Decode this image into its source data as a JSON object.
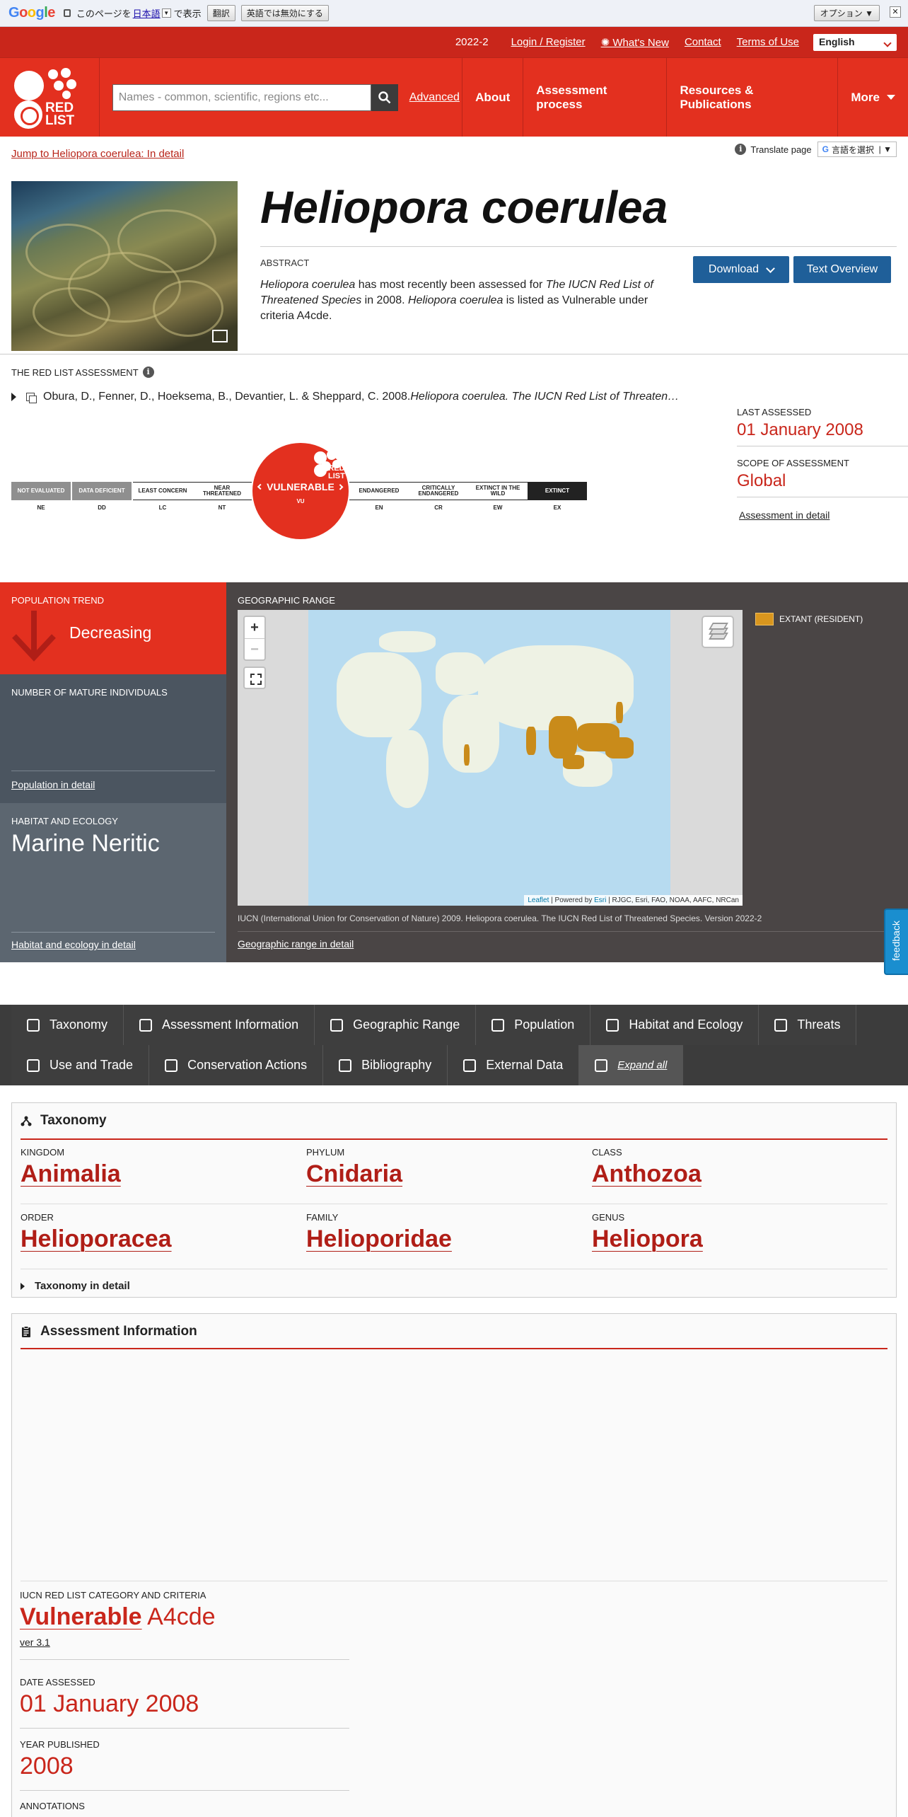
{
  "gtranslate": {
    "prefix": "このページを",
    "lang": "日本語",
    "suffix": "で表示",
    "translate_btn": "翻訳",
    "disable_btn": "英語では無効にする",
    "options": "オプション ▼",
    "close": "✕"
  },
  "topbar": {
    "version": "2022-2",
    "links": [
      "Login / Register",
      "What's New",
      "Contact",
      "Terms of Use"
    ],
    "language": "English"
  },
  "logo_text": "RED\nLIST",
  "search": {
    "placeholder": "Names - common, scientific, regions etc..."
  },
  "nav": {
    "advanced": "Advanced",
    "items": [
      "About",
      "Assessment process",
      "Resources & Publications",
      "More"
    ]
  },
  "jump_link": "Jump to Heliopora coerulea: In detail",
  "translate_page": {
    "label": "Translate page",
    "select": "言語を選択"
  },
  "species": {
    "name": "Heliopora coerulea",
    "abstract_label": "ABSTRACT",
    "abstract": [
      {
        "t": "Heliopora coerulea",
        "i": true
      },
      {
        "t": " has most recently been assessed for ",
        "i": false
      },
      {
        "t": "The IUCN Red List of Threatened Species",
        "i": true
      },
      {
        "t": " in 2008. ",
        "i": false
      },
      {
        "t": "Heliopora coerulea",
        "i": true
      },
      {
        "t": " is listed as Vulnerable under criteria A4cde.",
        "i": false
      }
    ],
    "download": "Download",
    "text_overview": "Text Overview"
  },
  "rla": {
    "label": "THE RED LIST ASSESSMENT",
    "citation_plain": "Obura, D., Fenner, D., Hoeksema, B., Devantier, L. & Sheppard, C. 2008. ",
    "citation_italic": "Heliopora coerulea. The IUCN Red List of Threaten…",
    "last_assessed_label": "LAST ASSESSED",
    "last_assessed": "01 January 2008",
    "scope_label": "SCOPE OF ASSESSMENT",
    "scope": "Global",
    "assessment_link": "Assessment in detail"
  },
  "scale": {
    "categories": [
      {
        "key": "ne",
        "label": "NOT EVALUATED",
        "abbr": "NE"
      },
      {
        "key": "dd",
        "label": "DATA DEFICIENT",
        "abbr": "DD"
      },
      {
        "key": "lc",
        "label": "LEAST CONCERN",
        "abbr": "LC"
      },
      {
        "key": "nt",
        "label": "NEAR THREATENED",
        "abbr": "NT"
      },
      {
        "key": "vu",
        "label": "VULNERABLE",
        "abbr": "VU"
      },
      {
        "key": "en",
        "label": "ENDANGERED",
        "abbr": "EN"
      },
      {
        "key": "cr",
        "label": "CRITICALLY ENDANGERED",
        "abbr": "CR"
      },
      {
        "key": "ew",
        "label": "EXTINCT IN THE WILD",
        "abbr": "EW"
      },
      {
        "key": "ex",
        "label": "EXTINCT",
        "abbr": "EX"
      }
    ],
    "active": "vu",
    "badge_text": "RED\nLIST"
  },
  "dashboard": {
    "pop_trend_label": "POPULATION TREND",
    "pop_trend": "Decreasing",
    "mature_label": "NUMBER OF MATURE INDIVIDUALS",
    "pop_link": "Population in detail",
    "habitat_label": "HABITAT AND ECOLOGY",
    "habitat": "Marine Neritic",
    "habitat_link": "Habitat and ecology in detail",
    "geo_label": "GEOGRAPHIC RANGE",
    "legend": "EXTANT (RESIDENT)",
    "map_attr_leaflet": "Leaflet",
    "map_attr_mid": " | Powered by ",
    "map_attr_esri": "Esri",
    "map_attr_rest": " | RJGC, Esri, FAO, NOAA, AAFC, NRCan",
    "map_citation": "IUCN (International Union for Conservation of Nature) 2009. Heliopora coerulea. The IUCN Red List of Threatened Species. Version 2022-2",
    "geo_link": "Geographic range in detail",
    "zoom_in": "+",
    "zoom_out": "−"
  },
  "feedback": "feedback",
  "tabs": {
    "row1": [
      "Taxonomy",
      "Assessment Information",
      "Geographic Range",
      "Population",
      "Habitat and Ecology",
      "Threats"
    ],
    "row2": [
      "Use and Trade",
      "Conservation Actions",
      "Bibliography",
      "External Data",
      "Expand all"
    ]
  },
  "taxonomy": {
    "heading": "Taxonomy",
    "fields": [
      {
        "label": "KINGDOM",
        "value": "Animalia"
      },
      {
        "label": "PHYLUM",
        "value": "Cnidaria"
      },
      {
        "label": "CLASS",
        "value": "Anthozoa"
      },
      {
        "label": "ORDER",
        "value": "Helioporacea"
      },
      {
        "label": "FAMILY",
        "value": "Helioporidae"
      },
      {
        "label": "GENUS",
        "value": "Heliopora"
      }
    ],
    "detail": "Taxonomy in detail"
  },
  "assessment": {
    "heading": "Assessment Information",
    "cat_label": "IUCN RED LIST CATEGORY AND CRITERIA",
    "cat": "Vulnerable",
    "criteria": "A4cde",
    "version": "ver 3.1",
    "date_label": "DATE ASSESSED",
    "date": "01 January 2008",
    "year_label": "YEAR PUBLISHED",
    "year": "2008",
    "annotations_label": "ANNOTATIONS"
  }
}
